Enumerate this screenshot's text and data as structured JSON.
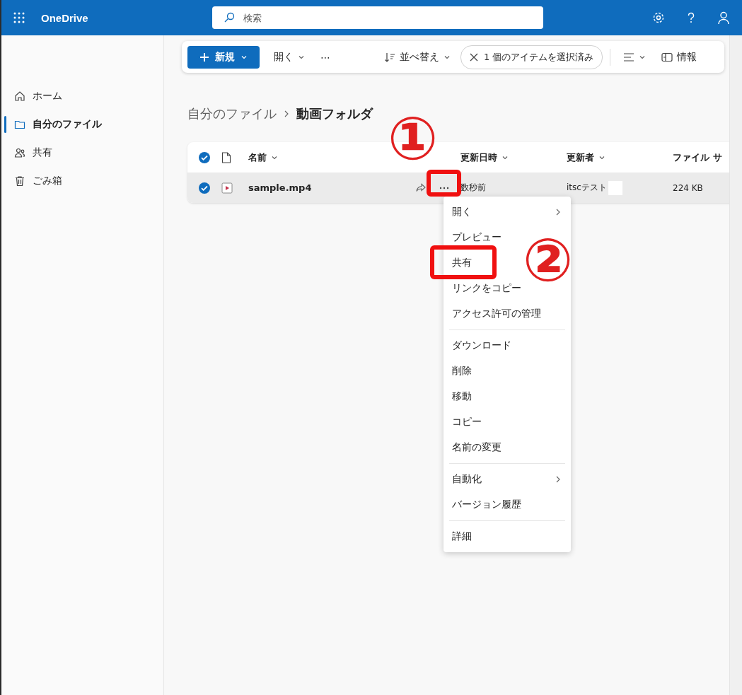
{
  "app_bar": {
    "title": "OneDrive",
    "search": {
      "placeholder": "検索"
    }
  },
  "sidebar": {
    "items": [
      {
        "label": "ホーム",
        "kind": "home",
        "selected": false
      },
      {
        "label": "自分のファイル",
        "kind": "folder",
        "selected": true
      },
      {
        "label": "共有",
        "kind": "people",
        "selected": false
      },
      {
        "label": "ごみ箱",
        "kind": "trash",
        "selected": false
      }
    ]
  },
  "command_bar": {
    "new_button": "新規",
    "open": "開く",
    "more": "⋯",
    "sort": "並べ替え",
    "selection": "1 個のアイテムを選択済み",
    "info": "情報"
  },
  "breadcrumb": [
    {
      "label": "自分のファイル",
      "current": false
    },
    {
      "label": "動画フォルダ",
      "current": true
    }
  ],
  "table": {
    "columns": [
      "名前",
      "更新日時",
      "更新者",
      "ファイル サ"
    ],
    "rows": [
      {
        "name": "sample.mp4",
        "modified": "数秒前",
        "modified_by": "itscテスト",
        "size": "224 KB",
        "selected": true
      }
    ]
  },
  "context_menu": {
    "groups": [
      [
        {
          "label": "開く",
          "submenu": true
        },
        {
          "label": "プレビュー",
          "submenu": false
        },
        {
          "label": "共有",
          "submenu": false
        },
        {
          "label": "リンクをコピー",
          "submenu": false
        },
        {
          "label": "アクセス許可の管理",
          "submenu": false
        }
      ],
      [
        {
          "label": "ダウンロード",
          "submenu": false
        },
        {
          "label": "削除",
          "submenu": false
        },
        {
          "label": "移動",
          "submenu": false
        },
        {
          "label": "コピー",
          "submenu": false
        },
        {
          "label": "名前の変更",
          "submenu": false
        }
      ],
      [
        {
          "label": "自動化",
          "submenu": true
        },
        {
          "label": "バージョン履歴",
          "submenu": false
        }
      ],
      [
        {
          "label": "詳細",
          "submenu": false
        }
      ]
    ]
  },
  "annotations": [
    {
      "label": "①"
    },
    {
      "label": "②"
    }
  ]
}
